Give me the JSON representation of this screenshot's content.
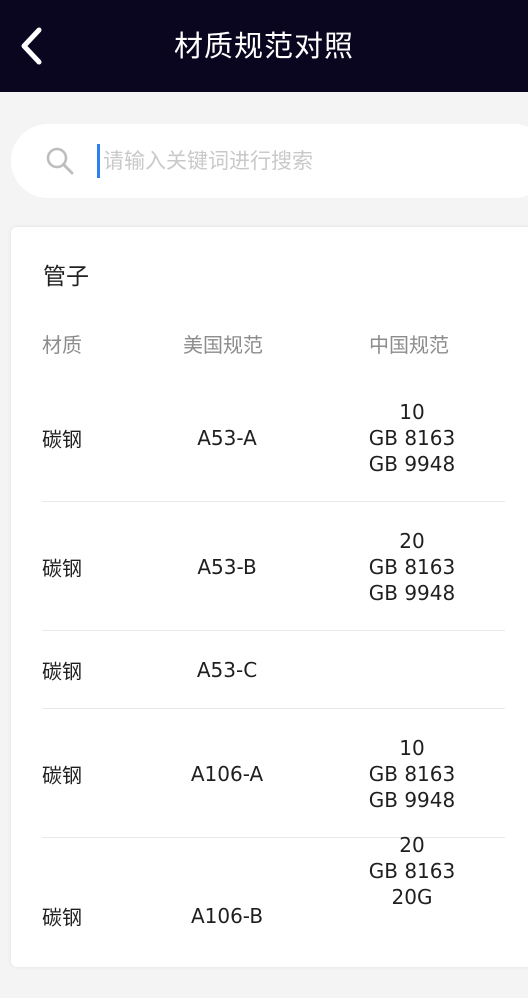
{
  "header": {
    "title": "材质规范对照",
    "back_icon": "chevron-left-icon"
  },
  "search": {
    "placeholder": "请输入关键词进行搜索",
    "value": "",
    "icon": "search-icon"
  },
  "section": {
    "title": "管子",
    "columns": {
      "material": "材质",
      "us_spec": "美国规范",
      "cn_spec": "中国规范"
    },
    "rows": [
      {
        "material": "碳钢",
        "us_spec": "A53-A",
        "cn_spec": [
          "10",
          "GB 8163",
          "GB 9948"
        ]
      },
      {
        "material": "碳钢",
        "us_spec": "A53-B",
        "cn_spec": [
          "20",
          "GB 8163",
          "GB 9948"
        ]
      },
      {
        "material": "碳钢",
        "us_spec": "A53-C",
        "cn_spec": []
      },
      {
        "material": "碳钢",
        "us_spec": "A106-A",
        "cn_spec": [
          "10",
          "GB 8163",
          "GB 9948"
        ]
      },
      {
        "material": "碳钢",
        "us_spec": "A106-B",
        "cn_spec": [
          "20",
          "GB 8163",
          "20G"
        ]
      }
    ]
  },
  "colors": {
    "header_bg": "#0b0620",
    "page_bg": "#f4f4f4",
    "caret": "#2f80ed"
  }
}
